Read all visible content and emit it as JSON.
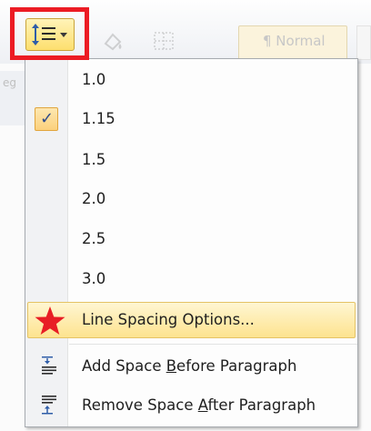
{
  "background": {
    "style_preview": "¶ Normal",
    "left_fragment": "eg"
  },
  "toolbar": {
    "line_spacing_button": {
      "icon": "line-spacing-icon",
      "highlight_color": "#ec1c24"
    }
  },
  "menu": {
    "spacing_options": [
      {
        "label": "1.0",
        "checked": false
      },
      {
        "label": "1.15",
        "checked": true
      },
      {
        "label": "1.5",
        "checked": false
      },
      {
        "label": "2.0",
        "checked": false
      },
      {
        "label": "2.5",
        "checked": false
      },
      {
        "label": "3.0",
        "checked": false
      }
    ],
    "check_glyph": "✓",
    "line_spacing_options": {
      "label": "Line Spacing Options...",
      "icon": "star-icon",
      "star_color": "#e81e25"
    },
    "add_space_before": {
      "pre": "Add Space ",
      "mnemonic": "B",
      "post": "efore Paragraph",
      "icon": "add-space-before-icon"
    },
    "remove_space_after": {
      "pre": "Remove Space ",
      "mnemonic": "A",
      "post": "fter Paragraph",
      "icon": "remove-space-after-icon"
    }
  }
}
